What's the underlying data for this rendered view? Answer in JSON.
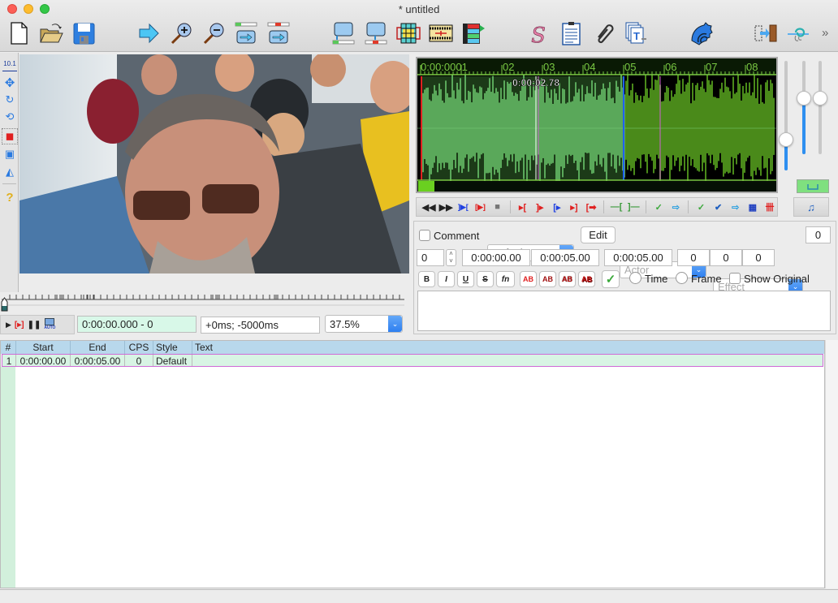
{
  "window": {
    "title": "* untitled"
  },
  "toolbar": {
    "items": [
      {
        "name": "new-file-icon"
      },
      {
        "name": "open-file-icon"
      },
      {
        "name": "save-file-icon"
      },
      {
        "name": "jump-to-icon"
      },
      {
        "name": "zoom-in-icon"
      },
      {
        "name": "zoom-out-icon"
      },
      {
        "name": "jump-to-start-icon"
      },
      {
        "name": "jump-to-end-icon"
      },
      {
        "name": "set-start-from-video-icon"
      },
      {
        "name": "set-end-from-video-icon"
      },
      {
        "name": "styles-manager-icon"
      },
      {
        "name": "properties-icon"
      },
      {
        "name": "attachments-icon"
      },
      {
        "name": "translation-assistant-icon"
      },
      {
        "name": "fonts-collector-icon"
      },
      {
        "name": "resample-icon"
      },
      {
        "name": "automation-icon"
      },
      {
        "name": "timing-postprocessor-icon"
      },
      {
        "name": "kanji-timer-icon"
      }
    ],
    "overflow_label": "»"
  },
  "left_tools": [
    {
      "name": "standard-tool-icon",
      "glyph": "10.1"
    },
    {
      "name": "drag-tool-icon",
      "glyph": "✥"
    },
    {
      "name": "rotate-z-tool-icon",
      "glyph": "↻"
    },
    {
      "name": "rotate-xy-tool-icon",
      "glyph": "⟲"
    },
    {
      "name": "scale-tool-icon",
      "glyph": "◼"
    },
    {
      "name": "clip-tool-icon",
      "glyph": "▣"
    },
    {
      "name": "vector-clip-tool-icon",
      "glyph": "◭"
    },
    {
      "name": "help-icon",
      "glyph": "?"
    }
  ],
  "video": {
    "time_display": "0:00:00.000 - 0",
    "offset_display": "+0ms; -5000ms",
    "zoom": "37.5%",
    "seek_position": 0
  },
  "audio": {
    "ruler_labels": [
      "0:00:0001",
      "02",
      "03",
      "04",
      "05",
      "06",
      "07",
      "08"
    ],
    "cursor_time": "0:00:02.78",
    "selection_start_s": 0.0,
    "selection_end_s": 5.0,
    "colors": {
      "ruler": "#7ac943",
      "selection_bg": "#1c3a18",
      "wave_selected": "#5aa85a",
      "wave_unselected": "#4a8a1a",
      "start_marker": "#e02020",
      "end_marker": "#2060f0",
      "keyframe": "#d060d0"
    }
  },
  "audio_toolbar": [
    {
      "name": "prev-line-icon",
      "glyph": "◀◀",
      "color": "#222"
    },
    {
      "name": "next-line-icon",
      "glyph": "▶▶",
      "color": "#222"
    },
    {
      "name": "play-selection-icon",
      "glyph": "]▶[",
      "color": "#2040e0"
    },
    {
      "name": "play-line-icon",
      "glyph": "[▶]",
      "color": "#e02020"
    },
    {
      "name": "stop-icon",
      "glyph": "■",
      "color": "#777"
    },
    {
      "sep": true
    },
    {
      "name": "play-500ms-before-icon",
      "glyph": "▸[",
      "color": "#e02020"
    },
    {
      "name": "play-500ms-after-icon",
      "glyph": "]▸",
      "color": "#e02020"
    },
    {
      "name": "play-first-500ms-icon",
      "glyph": "[▸",
      "color": "#2040e0"
    },
    {
      "name": "play-last-500ms-icon",
      "glyph": "▸]",
      "color": "#e02020"
    },
    {
      "name": "play-to-end-icon",
      "glyph": "[➡",
      "color": "#e02020"
    },
    {
      "sep": true
    },
    {
      "name": "lead-in-icon",
      "glyph": "—[",
      "color": "#3a9a3a"
    },
    {
      "name": "lead-out-icon",
      "glyph": "]—",
      "color": "#3a9a3a"
    },
    {
      "sep": true
    },
    {
      "name": "commit-icon",
      "glyph": "✓",
      "color": "#3aa83a"
    },
    {
      "name": "go-to-next-icon",
      "glyph": "⇨",
      "color": "#2aa0e0"
    },
    {
      "sep": true
    },
    {
      "name": "auto-commit-icon",
      "glyph": "✓",
      "color": "#3aa83a"
    },
    {
      "name": "next-line-on-commit-icon",
      "glyph": "✔",
      "color": "#2060c0"
    },
    {
      "name": "auto-scroll-icon",
      "glyph": "⇨",
      "color": "#2aa0e0"
    },
    {
      "name": "spectrum-mode-icon",
      "glyph": "▦",
      "color": "#2040c0"
    },
    {
      "name": "karaoke-icon",
      "glyph": "卌",
      "color": "#e02020"
    },
    {
      "sep": true
    },
    {
      "name": "audio-settings-icon",
      "glyph": "♫",
      "color": "#2060c0"
    }
  ],
  "audio_sliders": {
    "horizontal_zoom": 0.28,
    "vertical_zoom": 0.6,
    "volume": 0.6,
    "link_button_icon": "link-icon",
    "link_button_color": "#7fe07f"
  },
  "edit": {
    "comment_label": "Comment",
    "comment_checked": false,
    "style": "Default",
    "edit_label": "Edit",
    "actor_placeholder": "Actor",
    "effect_placeholder": "Effect",
    "char_count": "0",
    "layer": "0",
    "start_time": "0:00:00.00",
    "end_time": "0:00:05.00",
    "duration": "0:00:05.00",
    "margin_left": "0",
    "margin_right": "0",
    "margin_vertical": "0",
    "format_buttons": [
      {
        "name": "bold-button",
        "label": "B"
      },
      {
        "name": "italic-button",
        "label": "I"
      },
      {
        "name": "underline-button",
        "label": "U"
      },
      {
        "name": "strikeout-button",
        "label": "S"
      },
      {
        "name": "font-button",
        "label": "fn"
      },
      {
        "name": "primary-color-button",
        "label": "AB"
      },
      {
        "name": "secondary-color-button",
        "label": "AB"
      },
      {
        "name": "outline-color-button",
        "label": "AB"
      },
      {
        "name": "shadow-color-button",
        "label": "AB"
      }
    ],
    "commit_icon": "checkmark-icon",
    "time_label": "Time",
    "frame_label": "Frame",
    "show_original_label": "Show Original",
    "text": ""
  },
  "grid": {
    "columns": [
      "#",
      "Start",
      "End",
      "CPS",
      "Style",
      "Text"
    ],
    "rows": [
      {
        "num": "1",
        "start": "0:00:00.00",
        "end": "0:00:05.00",
        "cps": "0",
        "style": "Default",
        "text": ""
      }
    ]
  }
}
